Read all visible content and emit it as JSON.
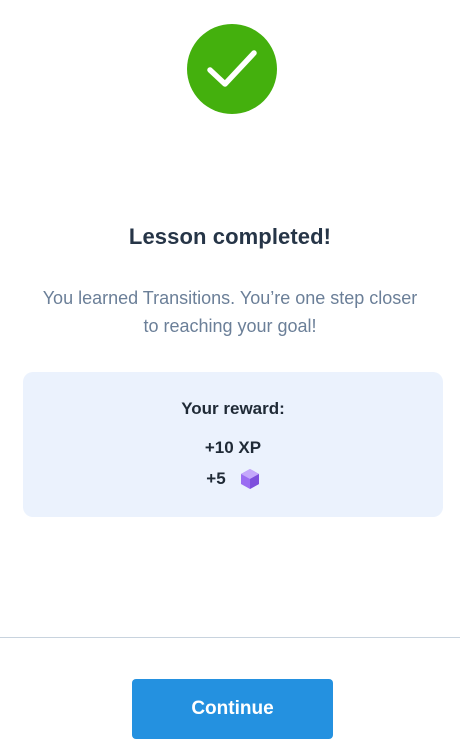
{
  "colors": {
    "success_green": "#44b00d",
    "card_background": "#ebf2fd",
    "button_blue": "#2491e0",
    "gem_purple": "#9b6df2"
  },
  "status_icon": "checkmark-icon",
  "title": "Lesson completed!",
  "subtitle": "You learned Transitions. You’re one step closer to reaching your goal!",
  "reward": {
    "heading": "Your reward:",
    "xp": "+10 XP",
    "gems": "+5",
    "gem_icon": "purple-gem-icon"
  },
  "actions": {
    "continue_label": "Continue"
  }
}
